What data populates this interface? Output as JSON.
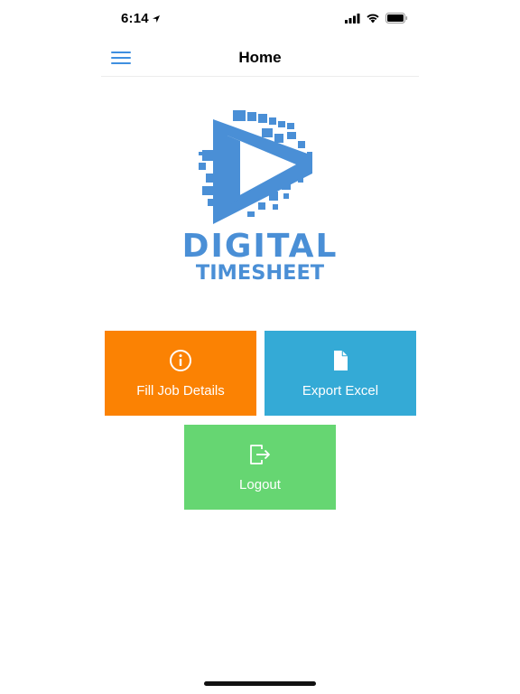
{
  "status_bar": {
    "time": "6:14"
  },
  "nav": {
    "title": "Home"
  },
  "logo": {
    "line1": "DIGITAL",
    "line2": "TIMESHEET"
  },
  "tiles": [
    {
      "label": "Fill Job Details",
      "icon": "info-circle-icon",
      "color": "#fb8203"
    },
    {
      "label": "Export Excel",
      "icon": "file-icon",
      "color": "#34aad6"
    },
    {
      "label": "Logout",
      "icon": "logout-icon",
      "color": "#66d672"
    }
  ],
  "colors": {
    "accent": "#3f8fe0",
    "logo_blue": "#4a8fd6"
  }
}
